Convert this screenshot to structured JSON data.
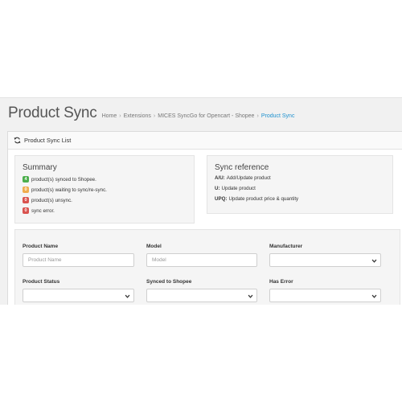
{
  "page": {
    "title": "Product Sync",
    "breadcrumb": [
      {
        "label": "Home",
        "active": false
      },
      {
        "label": "Extensions",
        "active": false
      },
      {
        "label": "MICES SyncGo for Opencart - Shopee",
        "active": false
      },
      {
        "label": "Product Sync",
        "active": true
      }
    ],
    "separator": "›"
  },
  "panel": {
    "icon": "refresh-icon",
    "title": "Product Sync List"
  },
  "summary": {
    "title": "Summary",
    "items": [
      {
        "count": "4",
        "color": "#4cae4c",
        "text": "product(s) synced to Shopee."
      },
      {
        "count": "0",
        "color": "#f0ad4e",
        "text": "product(s) waiting to sync/re-sync."
      },
      {
        "count": "0",
        "color": "#d9534f",
        "text": "product(s) unsync."
      },
      {
        "count": "0",
        "color": "#d9534f",
        "text": "sync error."
      }
    ]
  },
  "sync_reference": {
    "title": "Sync reference",
    "items": [
      {
        "code": "A/U:",
        "text": "Add/Update product"
      },
      {
        "code": "U:",
        "text": "Update product"
      },
      {
        "code": "UPQ:",
        "text": "Update product price & quantity"
      }
    ]
  },
  "filters": {
    "product_name": {
      "label": "Product Name",
      "placeholder": "Product Name",
      "value": ""
    },
    "model": {
      "label": "Model",
      "placeholder": "Model",
      "value": ""
    },
    "manufacturer": {
      "label": "Manufacturer",
      "value": ""
    },
    "product_status": {
      "label": "Product Status",
      "value": ""
    },
    "synced_to_shopee": {
      "label": "Synced to Shopee",
      "value": ""
    },
    "has_error": {
      "label": "Has Error",
      "value": ""
    }
  },
  "colors": {
    "accent": "#1e91cf",
    "success": "#4cae4c",
    "warning": "#f0ad4e",
    "danger": "#d9534f"
  }
}
